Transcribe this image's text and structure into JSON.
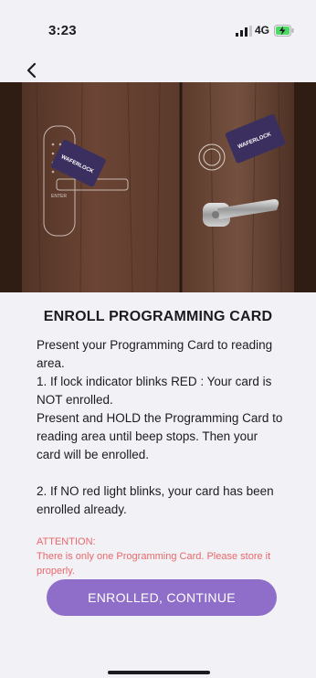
{
  "status_bar": {
    "time": "3:23",
    "network": "4G",
    "icons": [
      "signal-bars-icon",
      "battery-charging-icon"
    ]
  },
  "nav": {
    "back_icon": "chevron-left-icon"
  },
  "hero": {
    "card_brand_left": "WAFERLOCK",
    "card_brand_right": "WAFERLOCK",
    "keypad_label": "ENTER"
  },
  "title": "ENROLL PROGRAMMING CARD",
  "instructions": {
    "line1": "Present your Programming Card to reading area.",
    "line2": "1. If lock indicator blinks RED : Your card is NOT enrolled.",
    "line3": "Present and HOLD the Programming Card to reading area until beep stops. Then your card will be enrolled.",
    "line4": "2. If NO red light blinks, your card has been enrolled already."
  },
  "attention": {
    "heading": "ATTENTION:",
    "body": "There is only one Programming Card. Please store it properly."
  },
  "continue_button": "ENROLLED, CONTINUE",
  "colors": {
    "accent": "#8e6ec8",
    "attention": "#e8696b",
    "background": "#f2f1f6",
    "battery": "#4cd964"
  }
}
